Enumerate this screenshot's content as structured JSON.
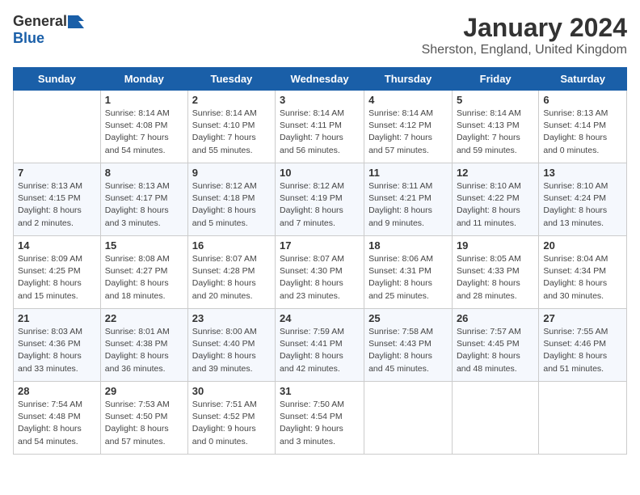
{
  "logo": {
    "general": "General",
    "blue": "Blue"
  },
  "title": "January 2024",
  "subtitle": "Sherston, England, United Kingdom",
  "days_header": [
    "Sunday",
    "Monday",
    "Tuesday",
    "Wednesday",
    "Thursday",
    "Friday",
    "Saturday"
  ],
  "weeks": [
    [
      {
        "day": "",
        "info": ""
      },
      {
        "day": "1",
        "info": "Sunrise: 8:14 AM\nSunset: 4:08 PM\nDaylight: 7 hours\nand 54 minutes."
      },
      {
        "day": "2",
        "info": "Sunrise: 8:14 AM\nSunset: 4:10 PM\nDaylight: 7 hours\nand 55 minutes."
      },
      {
        "day": "3",
        "info": "Sunrise: 8:14 AM\nSunset: 4:11 PM\nDaylight: 7 hours\nand 56 minutes."
      },
      {
        "day": "4",
        "info": "Sunrise: 8:14 AM\nSunset: 4:12 PM\nDaylight: 7 hours\nand 57 minutes."
      },
      {
        "day": "5",
        "info": "Sunrise: 8:14 AM\nSunset: 4:13 PM\nDaylight: 7 hours\nand 59 minutes."
      },
      {
        "day": "6",
        "info": "Sunrise: 8:13 AM\nSunset: 4:14 PM\nDaylight: 8 hours\nand 0 minutes."
      }
    ],
    [
      {
        "day": "7",
        "info": "Sunrise: 8:13 AM\nSunset: 4:15 PM\nDaylight: 8 hours\nand 2 minutes."
      },
      {
        "day": "8",
        "info": "Sunrise: 8:13 AM\nSunset: 4:17 PM\nDaylight: 8 hours\nand 3 minutes."
      },
      {
        "day": "9",
        "info": "Sunrise: 8:12 AM\nSunset: 4:18 PM\nDaylight: 8 hours\nand 5 minutes."
      },
      {
        "day": "10",
        "info": "Sunrise: 8:12 AM\nSunset: 4:19 PM\nDaylight: 8 hours\nand 7 minutes."
      },
      {
        "day": "11",
        "info": "Sunrise: 8:11 AM\nSunset: 4:21 PM\nDaylight: 8 hours\nand 9 minutes."
      },
      {
        "day": "12",
        "info": "Sunrise: 8:10 AM\nSunset: 4:22 PM\nDaylight: 8 hours\nand 11 minutes."
      },
      {
        "day": "13",
        "info": "Sunrise: 8:10 AM\nSunset: 4:24 PM\nDaylight: 8 hours\nand 13 minutes."
      }
    ],
    [
      {
        "day": "14",
        "info": "Sunrise: 8:09 AM\nSunset: 4:25 PM\nDaylight: 8 hours\nand 15 minutes."
      },
      {
        "day": "15",
        "info": "Sunrise: 8:08 AM\nSunset: 4:27 PM\nDaylight: 8 hours\nand 18 minutes."
      },
      {
        "day": "16",
        "info": "Sunrise: 8:07 AM\nSunset: 4:28 PM\nDaylight: 8 hours\nand 20 minutes."
      },
      {
        "day": "17",
        "info": "Sunrise: 8:07 AM\nSunset: 4:30 PM\nDaylight: 8 hours\nand 23 minutes."
      },
      {
        "day": "18",
        "info": "Sunrise: 8:06 AM\nSunset: 4:31 PM\nDaylight: 8 hours\nand 25 minutes."
      },
      {
        "day": "19",
        "info": "Sunrise: 8:05 AM\nSunset: 4:33 PM\nDaylight: 8 hours\nand 28 minutes."
      },
      {
        "day": "20",
        "info": "Sunrise: 8:04 AM\nSunset: 4:34 PM\nDaylight: 8 hours\nand 30 minutes."
      }
    ],
    [
      {
        "day": "21",
        "info": "Sunrise: 8:03 AM\nSunset: 4:36 PM\nDaylight: 8 hours\nand 33 minutes."
      },
      {
        "day": "22",
        "info": "Sunrise: 8:01 AM\nSunset: 4:38 PM\nDaylight: 8 hours\nand 36 minutes."
      },
      {
        "day": "23",
        "info": "Sunrise: 8:00 AM\nSunset: 4:40 PM\nDaylight: 8 hours\nand 39 minutes."
      },
      {
        "day": "24",
        "info": "Sunrise: 7:59 AM\nSunset: 4:41 PM\nDaylight: 8 hours\nand 42 minutes."
      },
      {
        "day": "25",
        "info": "Sunrise: 7:58 AM\nSunset: 4:43 PM\nDaylight: 8 hours\nand 45 minutes."
      },
      {
        "day": "26",
        "info": "Sunrise: 7:57 AM\nSunset: 4:45 PM\nDaylight: 8 hours\nand 48 minutes."
      },
      {
        "day": "27",
        "info": "Sunrise: 7:55 AM\nSunset: 4:46 PM\nDaylight: 8 hours\nand 51 minutes."
      }
    ],
    [
      {
        "day": "28",
        "info": "Sunrise: 7:54 AM\nSunset: 4:48 PM\nDaylight: 8 hours\nand 54 minutes."
      },
      {
        "day": "29",
        "info": "Sunrise: 7:53 AM\nSunset: 4:50 PM\nDaylight: 8 hours\nand 57 minutes."
      },
      {
        "day": "30",
        "info": "Sunrise: 7:51 AM\nSunset: 4:52 PM\nDaylight: 9 hours\nand 0 minutes."
      },
      {
        "day": "31",
        "info": "Sunrise: 7:50 AM\nSunset: 4:54 PM\nDaylight: 9 hours\nand 3 minutes."
      },
      {
        "day": "",
        "info": ""
      },
      {
        "day": "",
        "info": ""
      },
      {
        "day": "",
        "info": ""
      }
    ]
  ]
}
